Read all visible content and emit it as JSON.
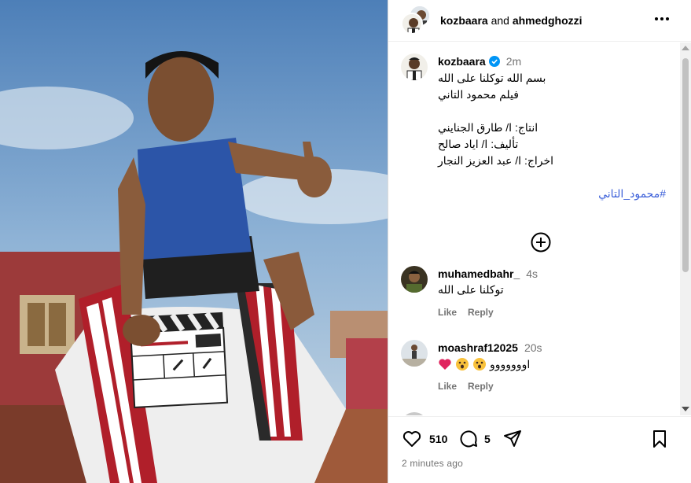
{
  "header": {
    "user1": "kozbaara",
    "and": "and",
    "user2": "ahmedghozzi",
    "more_icon": "more-horizontal-icon"
  },
  "caption": {
    "username": "kozbaara",
    "verified": true,
    "time": "2m",
    "lines": [
      "بسم الله توكلنا على الله",
      "فيلم محمود التاني",
      "",
      "انتاج: ا/ طارق الجنايني",
      "تأليف: ا/ اياد صالح",
      "اخراج: ا/ عبد العزيز النجار",
      ""
    ],
    "hashtag": "#محمود_التاني",
    "add_icon": "plus-circle-icon"
  },
  "comments": [
    {
      "username": "muhamedbahr_",
      "time": "4s",
      "text": "توكلنا على الله",
      "like_label": "Like",
      "reply_label": "Reply"
    },
    {
      "username": "moashraf12025",
      "time": "20s",
      "text": "اووووووو",
      "emojis": [
        "red-heart",
        "astonished-face",
        "astonished-face"
      ],
      "like_label": "Like",
      "reply_label": "Reply"
    }
  ],
  "footer": {
    "likes": "510",
    "comments": "5",
    "posted": "2 minutes ago",
    "icons": [
      "heart-icon",
      "comment-icon",
      "share-icon",
      "bookmark-icon"
    ]
  },
  "colors": {
    "link": "#3b5fd9",
    "verified": "#0095f6",
    "muted": "#737373",
    "heart": "#e0245e"
  }
}
